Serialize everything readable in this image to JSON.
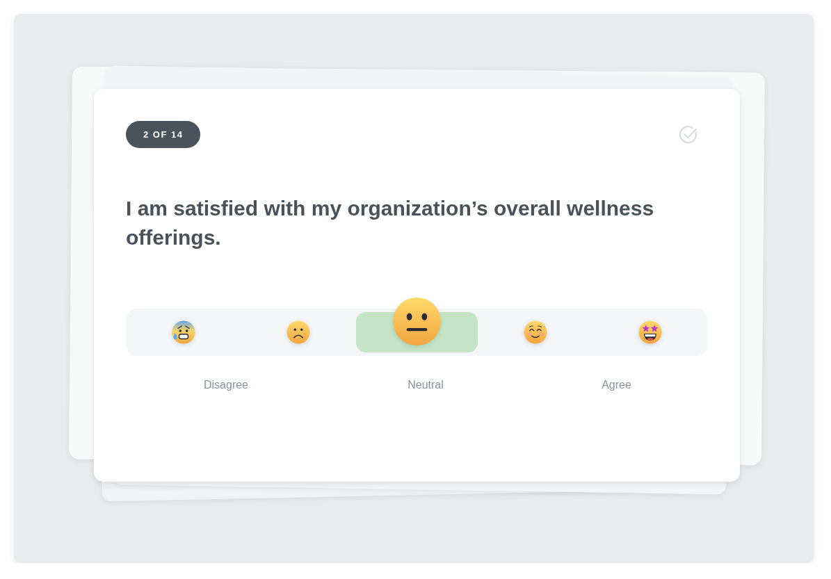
{
  "progress": {
    "label": "2 OF 14"
  },
  "question": {
    "text": "I am satisfied with my organization’s overall wellness offerings."
  },
  "scale": {
    "options": [
      {
        "kind": "anxious",
        "selected": false
      },
      {
        "kind": "frowning",
        "selected": false
      },
      {
        "kind": "neutral",
        "selected": true
      },
      {
        "kind": "smiling",
        "selected": false
      },
      {
        "kind": "starstruck",
        "selected": false
      }
    ],
    "labels": [
      "Disagree",
      "Neutral",
      "Agree"
    ]
  }
}
